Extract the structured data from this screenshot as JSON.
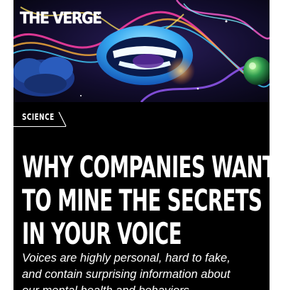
{
  "brand": {
    "logo_text": "THE VERGE"
  },
  "article": {
    "section": "SCIENCE",
    "headline_lines": [
      "WHY COMPANIES WANT",
      "TO MINE THE SECRETS",
      "IN YOUR VOICE"
    ],
    "dek_lines": [
      "Voices are highly personal, hard to fake,",
      "and contain surprising information about",
      "our mental health and behaviors."
    ]
  },
  "hero_image": {
    "subject": "mouth-illustration"
  },
  "colors": {
    "background": "#000000",
    "text": "#ffffff",
    "accent_blue": "#3fb6ff"
  }
}
